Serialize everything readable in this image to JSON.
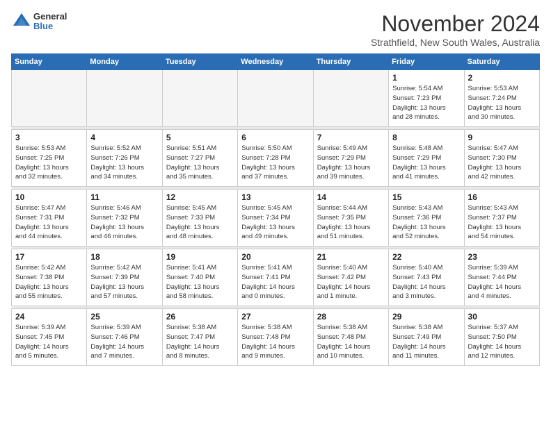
{
  "header": {
    "logo_general": "General",
    "logo_blue": "Blue",
    "month_title": "November 2024",
    "location": "Strathfield, New South Wales, Australia"
  },
  "calendar": {
    "days_of_week": [
      "Sunday",
      "Monday",
      "Tuesday",
      "Wednesday",
      "Thursday",
      "Friday",
      "Saturday"
    ],
    "weeks": [
      [
        {
          "day": "",
          "info": ""
        },
        {
          "day": "",
          "info": ""
        },
        {
          "day": "",
          "info": ""
        },
        {
          "day": "",
          "info": ""
        },
        {
          "day": "",
          "info": ""
        },
        {
          "day": "1",
          "info": "Sunrise: 5:54 AM\nSunset: 7:23 PM\nDaylight: 13 hours\nand 28 minutes."
        },
        {
          "day": "2",
          "info": "Sunrise: 5:53 AM\nSunset: 7:24 PM\nDaylight: 13 hours\nand 30 minutes."
        }
      ],
      [
        {
          "day": "3",
          "info": "Sunrise: 5:53 AM\nSunset: 7:25 PM\nDaylight: 13 hours\nand 32 minutes."
        },
        {
          "day": "4",
          "info": "Sunrise: 5:52 AM\nSunset: 7:26 PM\nDaylight: 13 hours\nand 34 minutes."
        },
        {
          "day": "5",
          "info": "Sunrise: 5:51 AM\nSunset: 7:27 PM\nDaylight: 13 hours\nand 35 minutes."
        },
        {
          "day": "6",
          "info": "Sunrise: 5:50 AM\nSunset: 7:28 PM\nDaylight: 13 hours\nand 37 minutes."
        },
        {
          "day": "7",
          "info": "Sunrise: 5:49 AM\nSunset: 7:29 PM\nDaylight: 13 hours\nand 39 minutes."
        },
        {
          "day": "8",
          "info": "Sunrise: 5:48 AM\nSunset: 7:29 PM\nDaylight: 13 hours\nand 41 minutes."
        },
        {
          "day": "9",
          "info": "Sunrise: 5:47 AM\nSunset: 7:30 PM\nDaylight: 13 hours\nand 42 minutes."
        }
      ],
      [
        {
          "day": "10",
          "info": "Sunrise: 5:47 AM\nSunset: 7:31 PM\nDaylight: 13 hours\nand 44 minutes."
        },
        {
          "day": "11",
          "info": "Sunrise: 5:46 AM\nSunset: 7:32 PM\nDaylight: 13 hours\nand 46 minutes."
        },
        {
          "day": "12",
          "info": "Sunrise: 5:45 AM\nSunset: 7:33 PM\nDaylight: 13 hours\nand 48 minutes."
        },
        {
          "day": "13",
          "info": "Sunrise: 5:45 AM\nSunset: 7:34 PM\nDaylight: 13 hours\nand 49 minutes."
        },
        {
          "day": "14",
          "info": "Sunrise: 5:44 AM\nSunset: 7:35 PM\nDaylight: 13 hours\nand 51 minutes."
        },
        {
          "day": "15",
          "info": "Sunrise: 5:43 AM\nSunset: 7:36 PM\nDaylight: 13 hours\nand 52 minutes."
        },
        {
          "day": "16",
          "info": "Sunrise: 5:43 AM\nSunset: 7:37 PM\nDaylight: 13 hours\nand 54 minutes."
        }
      ],
      [
        {
          "day": "17",
          "info": "Sunrise: 5:42 AM\nSunset: 7:38 PM\nDaylight: 13 hours\nand 55 minutes."
        },
        {
          "day": "18",
          "info": "Sunrise: 5:42 AM\nSunset: 7:39 PM\nDaylight: 13 hours\nand 57 minutes."
        },
        {
          "day": "19",
          "info": "Sunrise: 5:41 AM\nSunset: 7:40 PM\nDaylight: 13 hours\nand 58 minutes."
        },
        {
          "day": "20",
          "info": "Sunrise: 5:41 AM\nSunset: 7:41 PM\nDaylight: 14 hours\nand 0 minutes."
        },
        {
          "day": "21",
          "info": "Sunrise: 5:40 AM\nSunset: 7:42 PM\nDaylight: 14 hours\nand 1 minute."
        },
        {
          "day": "22",
          "info": "Sunrise: 5:40 AM\nSunset: 7:43 PM\nDaylight: 14 hours\nand 3 minutes."
        },
        {
          "day": "23",
          "info": "Sunrise: 5:39 AM\nSunset: 7:44 PM\nDaylight: 14 hours\nand 4 minutes."
        }
      ],
      [
        {
          "day": "24",
          "info": "Sunrise: 5:39 AM\nSunset: 7:45 PM\nDaylight: 14 hours\nand 5 minutes."
        },
        {
          "day": "25",
          "info": "Sunrise: 5:39 AM\nSunset: 7:46 PM\nDaylight: 14 hours\nand 7 minutes."
        },
        {
          "day": "26",
          "info": "Sunrise: 5:38 AM\nSunset: 7:47 PM\nDaylight: 14 hours\nand 8 minutes."
        },
        {
          "day": "27",
          "info": "Sunrise: 5:38 AM\nSunset: 7:48 PM\nDaylight: 14 hours\nand 9 minutes."
        },
        {
          "day": "28",
          "info": "Sunrise: 5:38 AM\nSunset: 7:48 PM\nDaylight: 14 hours\nand 10 minutes."
        },
        {
          "day": "29",
          "info": "Sunrise: 5:38 AM\nSunset: 7:49 PM\nDaylight: 14 hours\nand 11 minutes."
        },
        {
          "day": "30",
          "info": "Sunrise: 5:37 AM\nSunset: 7:50 PM\nDaylight: 14 hours\nand 12 minutes."
        }
      ]
    ]
  }
}
